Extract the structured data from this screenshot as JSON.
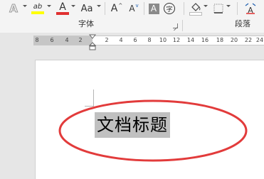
{
  "ribbon": {
    "font_group_label": "字体",
    "paragraph_group_label": "段落",
    "change_case_label": "Aa",
    "grow_font_label": "A",
    "shrink_font_label": "A",
    "clear_format_label": "A",
    "phonetic_label": "字",
    "highlight_label": "ab",
    "font_color_label": "A",
    "text_effects_label": "A",
    "highlight_color": "#ffff00",
    "font_color": "#e03030"
  },
  "ruler": {
    "left_ticks": [
      "8",
      "6",
      "4",
      "2"
    ],
    "right_ticks": [
      "2",
      "4",
      "6",
      "8",
      "10",
      "12",
      "14",
      "16",
      "18",
      "20",
      "22",
      "24"
    ]
  },
  "document": {
    "title_text": "文档标题",
    "selection_color": "#c0c0c0",
    "annotation_color": "#e23b3b"
  }
}
